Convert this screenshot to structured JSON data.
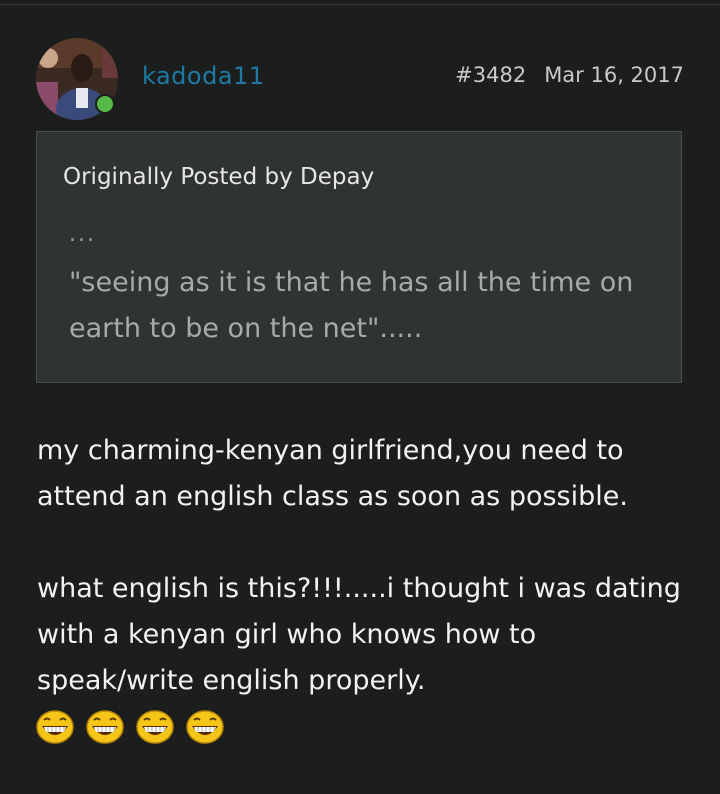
{
  "post": {
    "username": "kadoda11",
    "post_number": "#3482",
    "date": "Mar 16, 2017",
    "online_status_color": "#58b948",
    "username_color": "#1e7aa4"
  },
  "quote": {
    "attribution": "Originally Posted by Depay",
    "ellipsis": "...",
    "text": "\"seeing as it is that he has all the time on earth to be on the net\"....."
  },
  "body": {
    "paragraph_1": "my charming-kenyan girlfriend,you need to attend an english class as soon as possible.",
    "paragraph_2": "what english is this?!!!.....i thought i was dating with a kenyan girl who knows how to speak/write english properly."
  },
  "emojis": [
    {
      "icon": "grinning-face-icon"
    },
    {
      "icon": "grinning-face-icon"
    },
    {
      "icon": "grinning-face-icon"
    },
    {
      "icon": "grinning-face-icon"
    }
  ]
}
